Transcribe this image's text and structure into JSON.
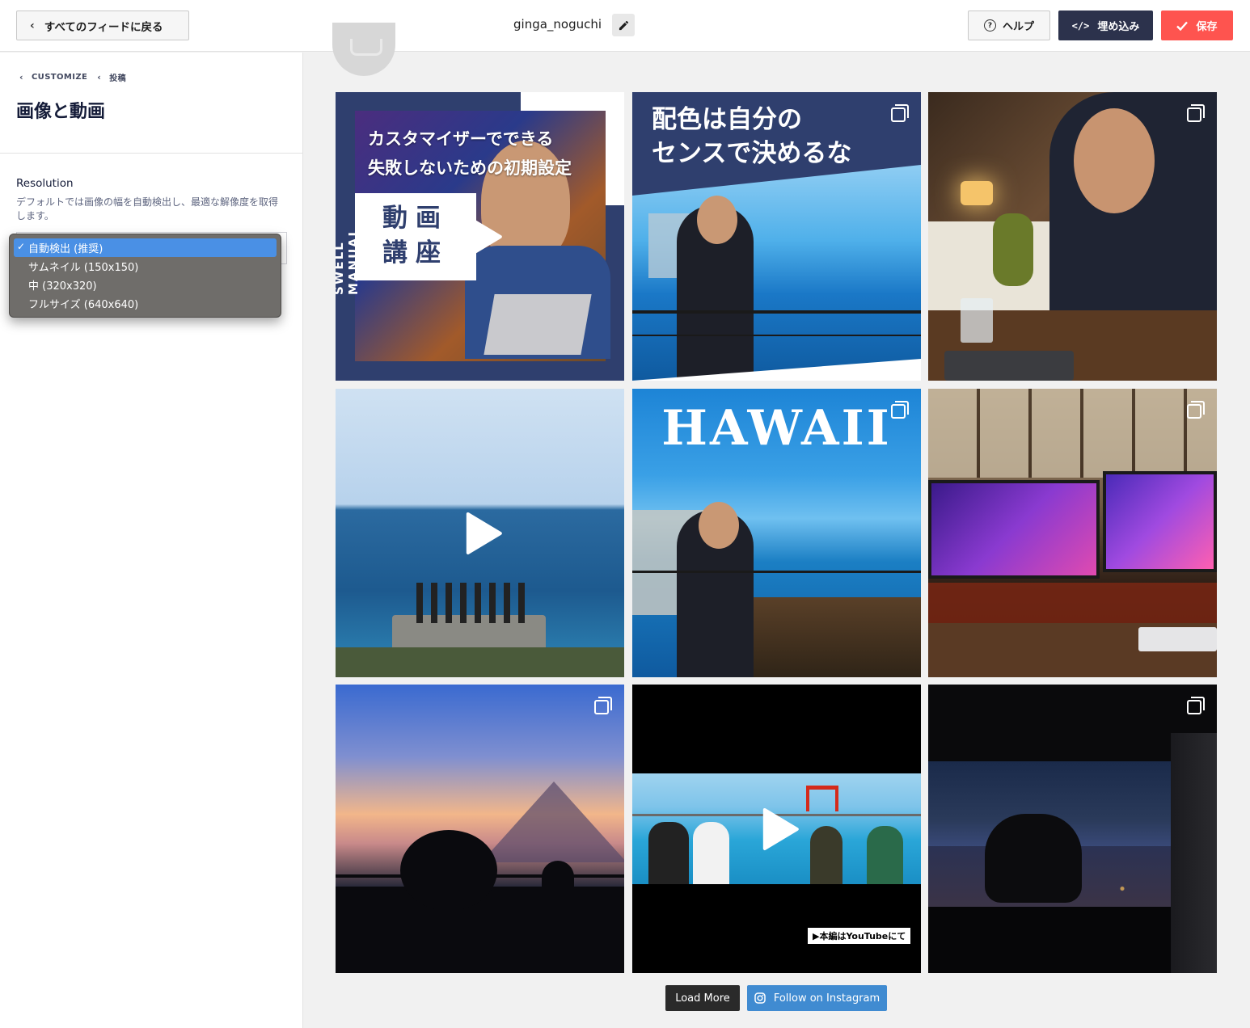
{
  "header": {
    "back_label": "すべてのフィードに戻る",
    "feed_name": "ginga_noguchi",
    "help_label": "ヘルプ",
    "embed_label": "埋め込み",
    "save_label": "保存"
  },
  "sidebar": {
    "breadcrumb": [
      "CUSTOMIZE",
      "投稿"
    ],
    "title": "画像と動画",
    "resolution_label": "Resolution",
    "resolution_desc": "デフォルトでは画像の幅を自動検出し、最適な解像度を取得します。",
    "resolution_options": [
      {
        "label": "自動検出 (推奨)",
        "selected": true
      },
      {
        "label": "サムネイル (150x150)",
        "selected": false
      },
      {
        "label": "中 (320x320)",
        "selected": false
      },
      {
        "label": "フルサイズ (640x640)",
        "selected": false
      }
    ]
  },
  "posts": [
    {
      "type": "video",
      "icon": "play-icon",
      "caption_lines": [
        "カスタマイザーでできる",
        "失敗しないための初期設定"
      ],
      "badge": "動画講座",
      "side_text": "SWELL MANUAL"
    },
    {
      "type": "carousel",
      "icon": "multi-image-icon",
      "caption_lines": [
        "配色は自分の",
        "センスで決めるな"
      ]
    },
    {
      "type": "carousel",
      "icon": "multi-image-icon"
    },
    {
      "type": "video",
      "icon": "play-icon"
    },
    {
      "type": "carousel",
      "icon": "multi-image-icon",
      "caption_lines": [
        "HAWAII"
      ]
    },
    {
      "type": "carousel",
      "icon": "multi-image-icon"
    },
    {
      "type": "carousel",
      "icon": "multi-image-icon"
    },
    {
      "type": "video",
      "icon": "play-icon",
      "caption_lines": [
        "▶本編はYouTubeにて"
      ]
    },
    {
      "type": "carousel",
      "icon": "multi-image-icon"
    }
  ],
  "footer": {
    "load_more_label": "Load More",
    "follow_label": "Follow on Instagram"
  },
  "colors": {
    "accent_dark": "#2c324c",
    "accent_save": "#fe544f",
    "follow_blue": "#408bd1",
    "select_blue": "#4a90e5"
  }
}
